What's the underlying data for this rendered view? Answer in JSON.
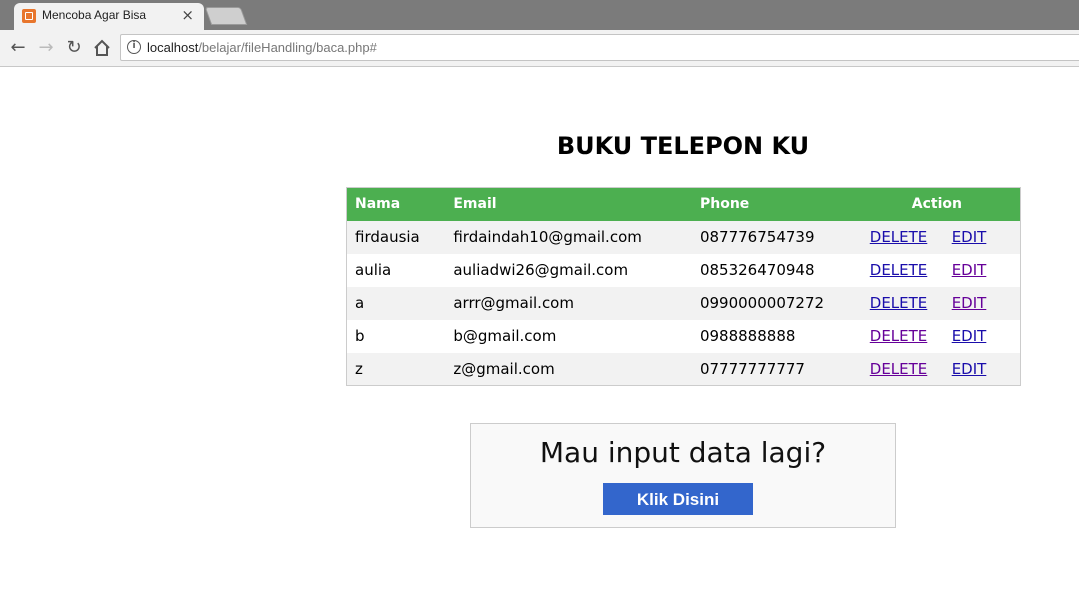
{
  "browser": {
    "tab_title": "Mencoba Agar Bisa",
    "tab_close": "×",
    "url_host": "localhost",
    "url_path": "/belajar/fileHandling/baca.php#",
    "icons": {
      "back": "arrow-left-icon",
      "forward": "arrow-right-icon",
      "reload": "reload-icon",
      "home": "home-icon",
      "info": "info-icon"
    }
  },
  "page": {
    "title": "BUKU TELEPON KU",
    "table": {
      "headers": {
        "nama": "Nama",
        "email": "Email",
        "phone": "Phone",
        "action": "Action"
      },
      "rows": [
        {
          "nama": "firdausia",
          "email": "firdaindah10@gmail.com",
          "phone": "087776754739",
          "delete": "DELETE",
          "edit": "EDIT"
        },
        {
          "nama": "aulia",
          "email": "auliadwi26@gmail.com",
          "phone": "085326470948",
          "delete": "DELETE",
          "edit": "EDIT"
        },
        {
          "nama": "a",
          "email": "arrr@gmail.com",
          "phone": "0990000007272",
          "delete": "DELETE",
          "edit": "EDIT"
        },
        {
          "nama": "b",
          "email": "b@gmail.com",
          "phone": "0988888888",
          "delete": "DELETE",
          "edit": "EDIT"
        },
        {
          "nama": "z",
          "email": "z@gmail.com",
          "phone": "07777777777",
          "delete": "DELETE",
          "edit": "EDIT"
        }
      ]
    },
    "cta": {
      "text": "Mau input data lagi?",
      "button_label": "Klik Disini"
    },
    "colors": {
      "header_green": "#4caf50",
      "button_blue": "#3366cc",
      "link": "#1a0dab",
      "link_visited": "#660099"
    }
  }
}
